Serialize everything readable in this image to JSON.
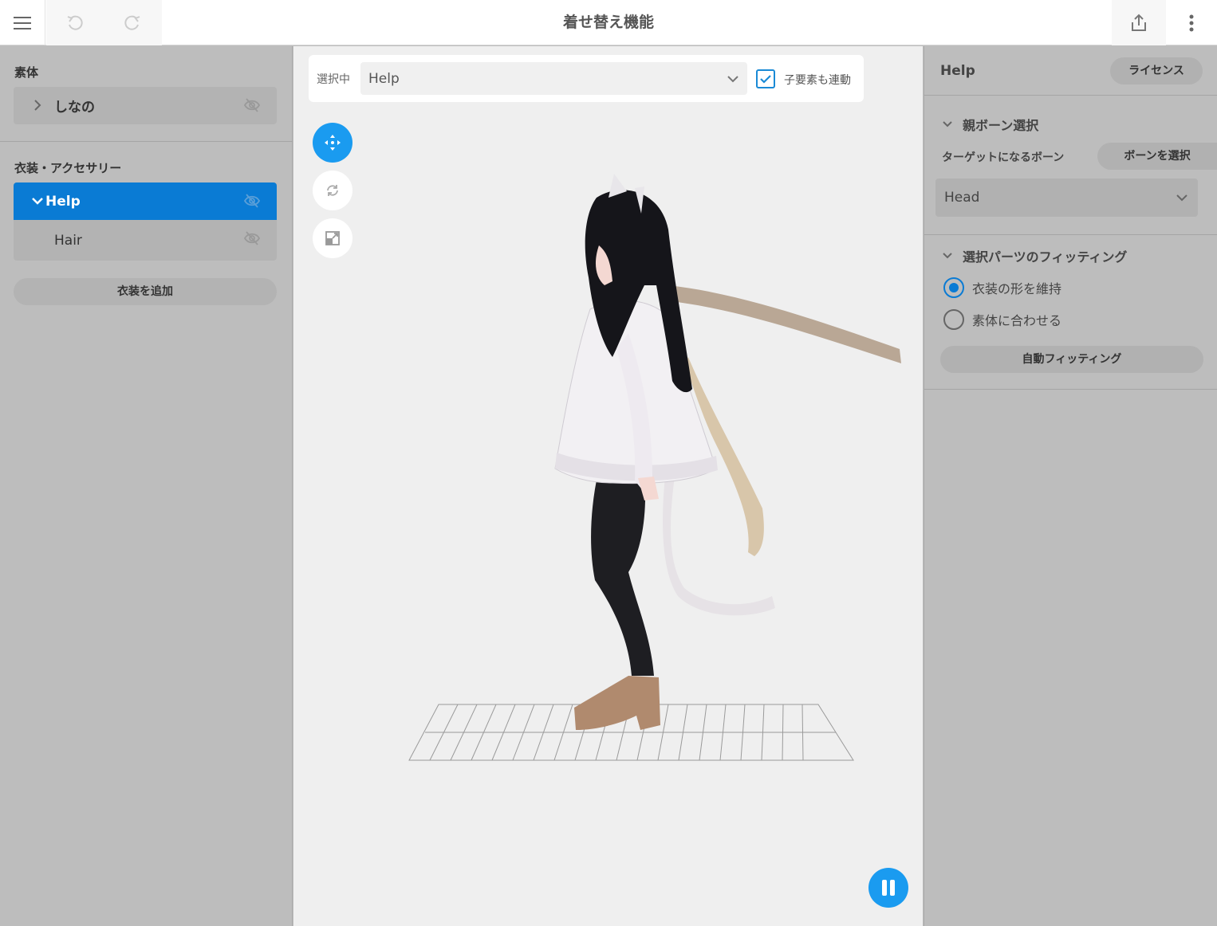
{
  "header": {
    "title": "着せ替え機能"
  },
  "left": {
    "body_section_label": "素体",
    "body_items": [
      {
        "label": "しなの"
      }
    ],
    "outfit_section_label": "衣装・アクセサリー",
    "outfit_items": [
      {
        "label": "Help",
        "selected": true
      },
      {
        "label": "Hair",
        "selected": false
      }
    ],
    "add_outfit_label": "衣装を追加"
  },
  "center": {
    "selected_label": "選択中",
    "selected_value": "Help",
    "link_children_label": "子要素も連動",
    "link_children_checked": true
  },
  "right": {
    "title": "Help",
    "license_label": "ライセンス",
    "parent_bone_section": "親ボーン選択",
    "target_bone_label": "ターゲットになるボーン",
    "select_bone_button": "ボーンを選択",
    "bone_value": "Head",
    "fitting_section": "選択パーツのフィッティング",
    "fitting_options": [
      {
        "label": "衣装の形を維持",
        "selected": true
      },
      {
        "label": "素体に合わせる",
        "selected": false
      }
    ],
    "auto_fit_button": "自動フィッティング"
  },
  "colors": {
    "accent": "#1a9bf0",
    "selected_row": "#0a7bd4",
    "panel_bg": "#bdbdbd",
    "viewport_bg": "#efefef"
  }
}
